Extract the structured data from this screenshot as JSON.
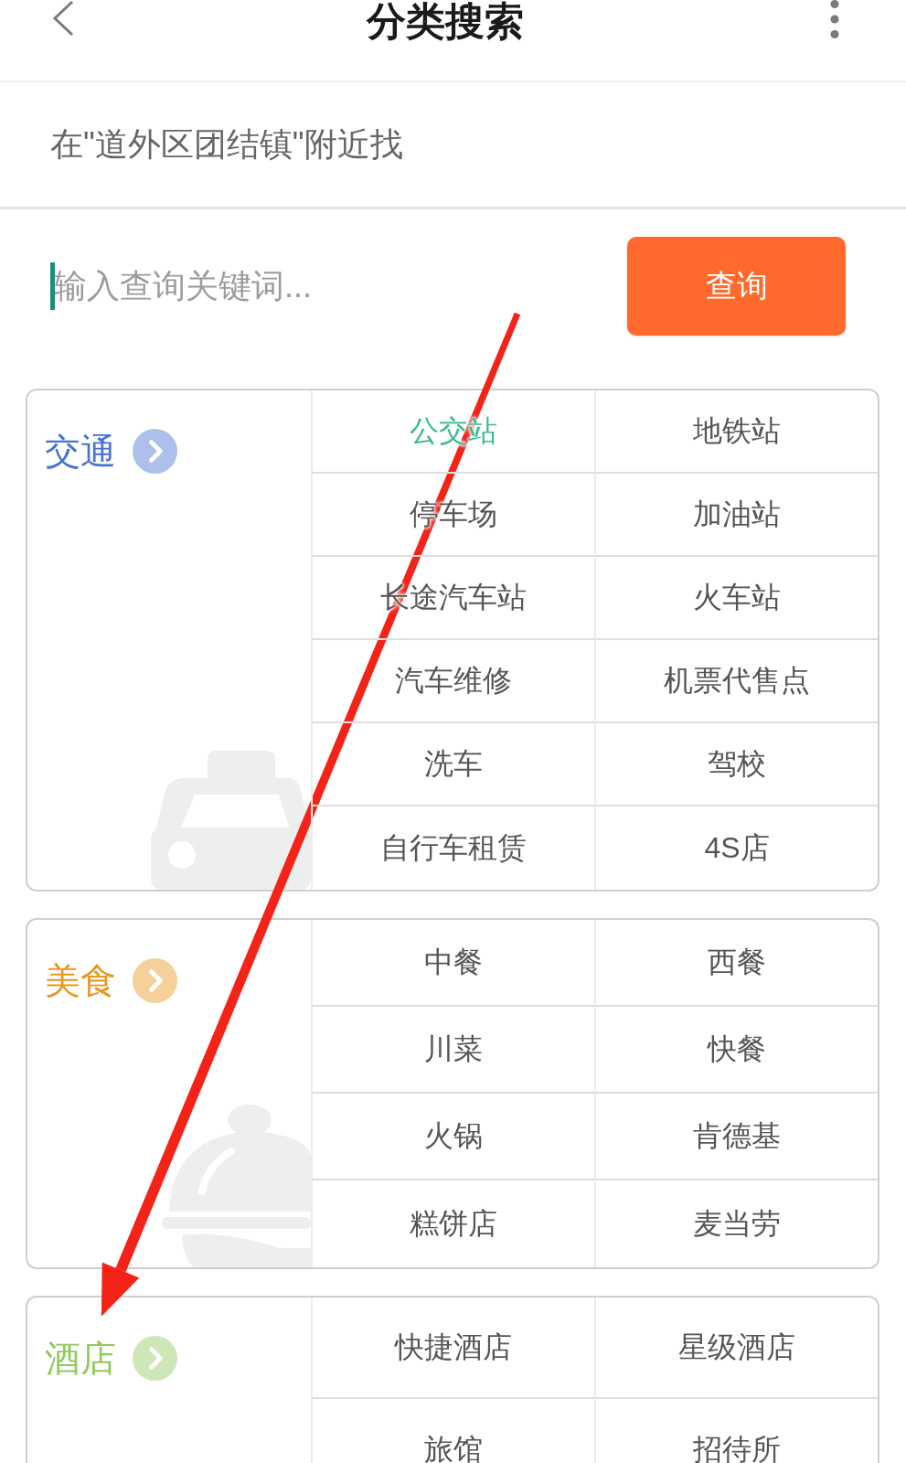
{
  "header": {
    "title": "分类搜索"
  },
  "location": {
    "text": "在\"道外区团结镇\"附近找"
  },
  "search": {
    "placeholder": "输入查询关键词...",
    "focused": true,
    "button": "查询"
  },
  "categories": [
    {
      "title": "交通",
      "kind": "transit",
      "color": "#4673d2",
      "items": [
        {
          "label": "公交站",
          "selected": true
        },
        {
          "label": "地铁站",
          "selected": false
        },
        {
          "label": "停车场",
          "selected": false
        },
        {
          "label": "加油站",
          "selected": false
        },
        {
          "label": "长途汽车站",
          "selected": false
        },
        {
          "label": "火车站",
          "selected": false
        },
        {
          "label": "汽车维修",
          "selected": false
        },
        {
          "label": "机票代售点",
          "selected": false
        },
        {
          "label": "洗车",
          "selected": false
        },
        {
          "label": "驾校",
          "selected": false
        },
        {
          "label": "自行车租赁",
          "selected": false
        },
        {
          "label": "4S店",
          "selected": false
        }
      ]
    },
    {
      "title": "美食",
      "kind": "food",
      "color": "#e8961e",
      "items": [
        {
          "label": "中餐",
          "selected": false
        },
        {
          "label": "西餐",
          "selected": false
        },
        {
          "label": "川菜",
          "selected": false
        },
        {
          "label": "快餐",
          "selected": false
        },
        {
          "label": "火锅",
          "selected": false
        },
        {
          "label": "肯德基",
          "selected": false
        },
        {
          "label": "糕饼店",
          "selected": false
        },
        {
          "label": "麦当劳",
          "selected": false
        }
      ]
    },
    {
      "title": "酒店",
      "kind": "hotel",
      "color": "#8fca5c",
      "items": [
        {
          "label": "快捷酒店",
          "selected": false
        },
        {
          "label": "星级酒店",
          "selected": false
        },
        {
          "label": "旅馆",
          "selected": false
        },
        {
          "label": "招待所",
          "selected": false
        }
      ]
    }
  ]
}
